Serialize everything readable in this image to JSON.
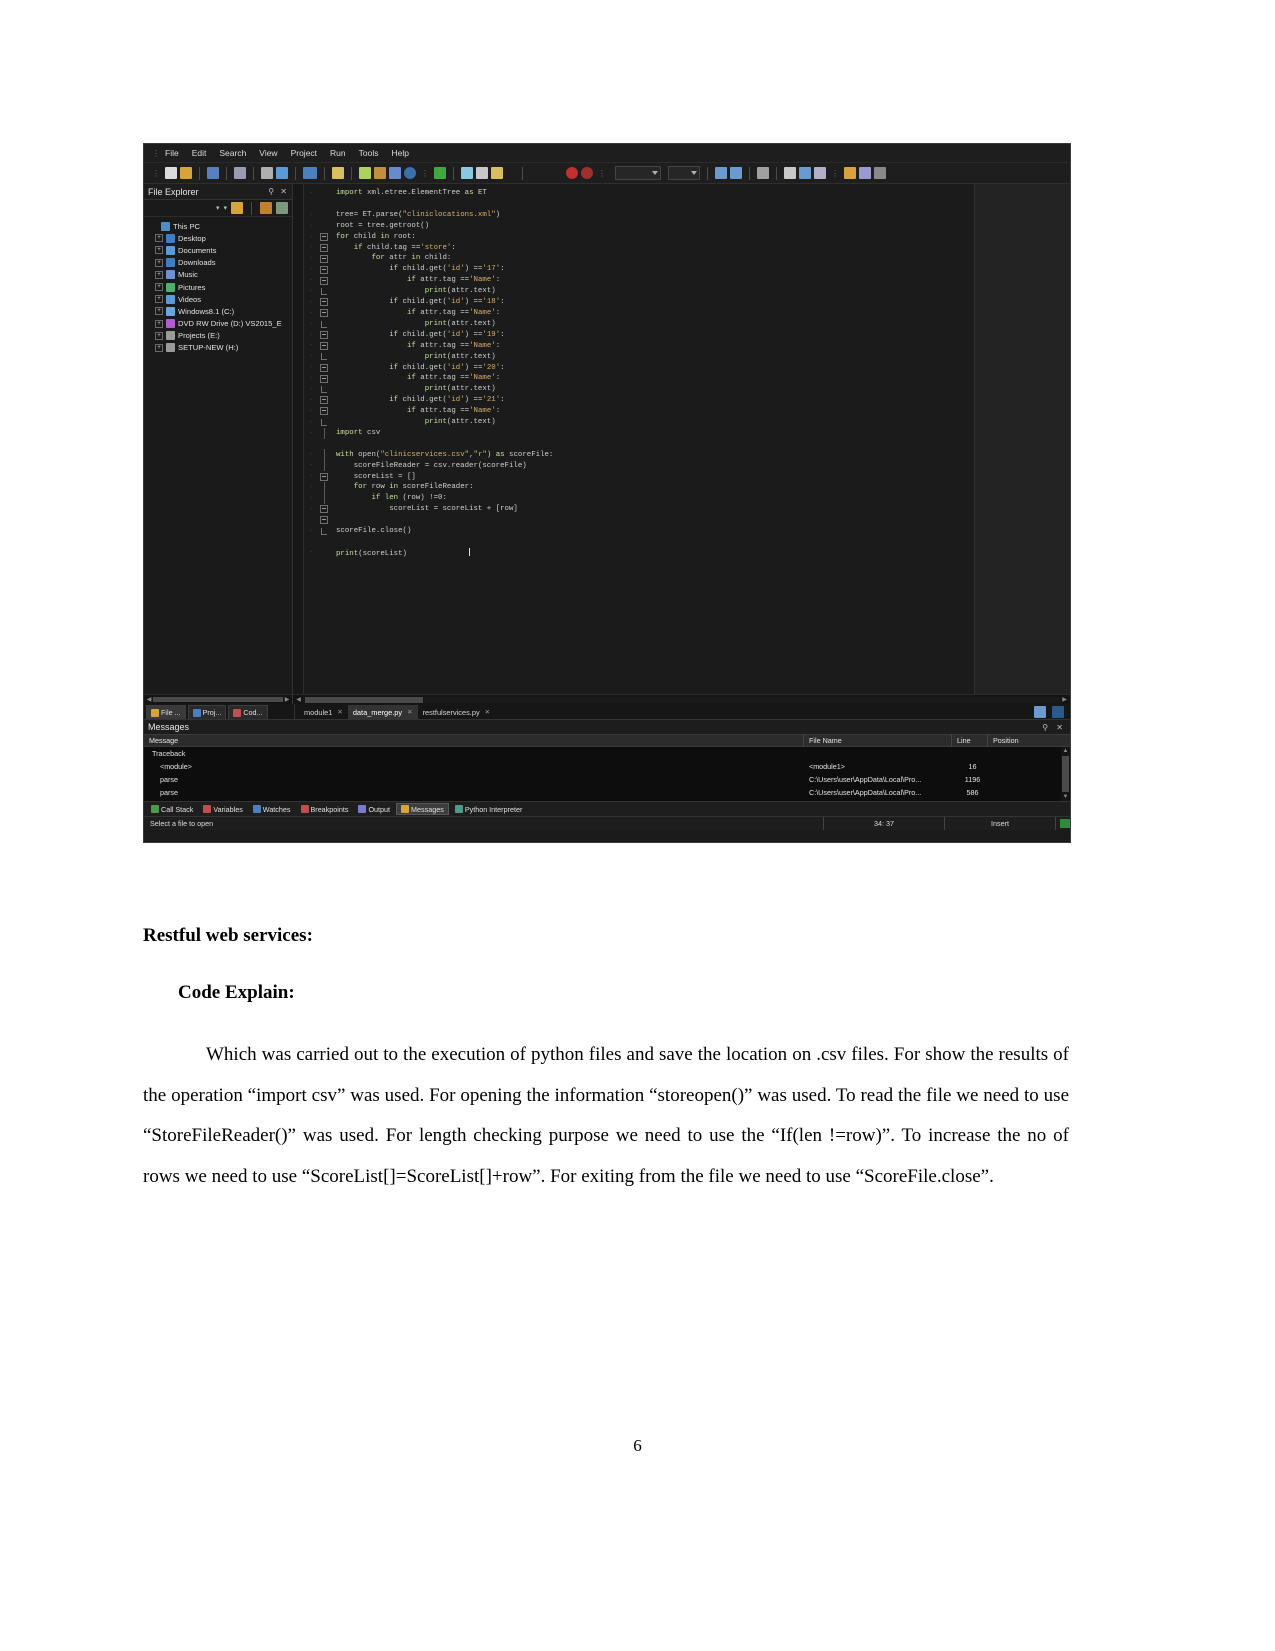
{
  "ide": {
    "menubar": {
      "items": [
        "File",
        "Edit",
        "Search",
        "View",
        "Project",
        "Run",
        "Tools",
        "Help"
      ]
    },
    "toolbar": {
      "icons": [
        "new-file-icon",
        "open-folder-icon",
        "save-icon",
        "print-icon",
        "cut-icon",
        "copy-icon",
        "undo-icon",
        "find-icon",
        "debug-icon",
        "module-icon",
        "window-icon",
        "info-icon",
        "run-icon",
        "debug-run-icon",
        "step-over-icon",
        "step-into-icon",
        "breakpoint-icon",
        "stop-icon",
        "bookmark-icon",
        "indent-icon",
        "outdent-icon",
        "comment-icon",
        "list-icon",
        "doc-icon",
        "format-icon",
        "settings-icon",
        "grid-icon",
        "panel-icon"
      ]
    },
    "explorer": {
      "title": "File Explorer",
      "pin_label": "⚲",
      "close_label": "✕",
      "tree": [
        {
          "label": "This PC",
          "indent": 0,
          "expandable": false,
          "icon_color": "#4a8fc8"
        },
        {
          "label": "Desktop",
          "indent": 1,
          "expandable": true,
          "icon_color": "#3f7fbf"
        },
        {
          "label": "Documents",
          "indent": 1,
          "expandable": true,
          "icon_color": "#5a9ad6"
        },
        {
          "label": "Downloads",
          "indent": 1,
          "expandable": true,
          "icon_color": "#3f7fbf"
        },
        {
          "label": "Music",
          "indent": 1,
          "expandable": true,
          "icon_color": "#6f8fcf"
        },
        {
          "label": "Pictures",
          "indent": 1,
          "expandable": true,
          "icon_color": "#4fae6f"
        },
        {
          "label": "Videos",
          "indent": 1,
          "expandable": true,
          "icon_color": "#5a9ad6"
        },
        {
          "label": "Windows8.1 (C:)",
          "indent": 1,
          "expandable": true,
          "icon_color": "#6aa6d9"
        },
        {
          "label": "DVD RW Drive (D:) VS2015_E",
          "indent": 1,
          "expandable": true,
          "icon_color": "#b05ecf"
        },
        {
          "label": "Projects (E:)",
          "indent": 1,
          "expandable": true,
          "icon_color": "#9a9a9a"
        },
        {
          "label": "SETUP-NEW (H:)",
          "indent": 1,
          "expandable": true,
          "icon_color": "#9a9a9a"
        }
      ]
    },
    "editor": {
      "code": "import xml.etree.ElementTree as ET\n\ntree= ET.parse(\"cliniclocations.xml\")\nroot = tree.getroot()\nfor child in root:\n    if child.tag =='store':\n        for attr in child:\n            if child.get('id') =='17':\n                if attr.tag =='Name':\n                    print(attr.text)\n            if child.get('id') =='18':\n                if attr.tag =='Name':\n                    print(attr.text)\n            if child.get('id') =='19':\n                if attr.tag =='Name':\n                    print(attr.text)\n            if child.get('id') =='20':\n                if attr.tag =='Name':\n                    print(attr.text)\n            if child.get('id') =='21':\n                if attr.tag =='Name':\n                    print(attr.text)\nimport csv\n\nwith open(\"clinicservices.csv\",\"r\") as scoreFile:\n    scoreFileReader = csv.reader(scoreFile)\n    scoreList = []\n    for row in scoreFileReader:\n        if len (row) !=0:\n            scoreList = scoreList + [row]\n\nscoreFile.close()\n\nprint(scoreList)"
    },
    "dock_left_tabs": [
      {
        "label": "File ...",
        "active": true,
        "icon_color": "#d8a33c"
      },
      {
        "label": "Proj...",
        "active": false,
        "icon_color": "#4a7fc0"
      },
      {
        "label": "Cod...",
        "active": false,
        "icon_color": "#c05050"
      }
    ],
    "editor_tabs": [
      {
        "label": "module1",
        "active": false,
        "close": "✕"
      },
      {
        "label": "data_merge.py",
        "active": true,
        "close": "✕"
      },
      {
        "label": "restfulservices.py",
        "active": false,
        "close": "✕"
      }
    ],
    "messages": {
      "title": "Messages",
      "pin_label": "⚲",
      "close_label": "✕",
      "columns": [
        "Message",
        "File Name",
        "Line",
        "Position"
      ],
      "rows": [
        {
          "message": "Traceback",
          "file": "",
          "line": "",
          "position": ""
        },
        {
          "message": "<module>",
          "file": "<module1>",
          "line": "16",
          "position": ""
        },
        {
          "message": "parse",
          "file": "C:\\Users\\user\\AppData\\Local\\Pro...",
          "line": "1196",
          "position": ""
        },
        {
          "message": "parse",
          "file": "C:\\Users\\user\\AppData\\Local\\Pro...",
          "line": "586",
          "position": ""
        }
      ]
    },
    "bottom_tabs": [
      {
        "label": "Call Stack",
        "active": false,
        "icon_color": "#4f9a4f"
      },
      {
        "label": "Variables",
        "active": false,
        "icon_color": "#c05050"
      },
      {
        "label": "Watches",
        "active": false,
        "icon_color": "#4a7fc0"
      },
      {
        "label": "Breakpoints",
        "active": false,
        "icon_color": "#c05050"
      },
      {
        "label": "Output",
        "active": false,
        "icon_color": "#7a7ad0"
      },
      {
        "label": "Messages",
        "active": true,
        "icon_color": "#d8a33c"
      },
      {
        "label": "Python Interpreter",
        "active": false,
        "icon_color": "#4f9a8a"
      }
    ],
    "statusbar": {
      "hint": "Select a file to open",
      "cursor": "34: 37",
      "mode": "Insert",
      "indicator_color": "#2d8a3e"
    }
  },
  "document": {
    "heading1": "Restful web services:",
    "heading2": "Code Explain:",
    "paragraph": "Which was carried out to the execution of python files and save the location on .csv files. For show the results of the operation “import csv” was used. For opening the information “storeopen()”  was used. To read the file we need to use “StoreFileReader()” was used. For length checking purpose we need to use the “If(len !=row)”. To increase the no of rows we need to use “ScoreList[]=ScoreList[]+row”. For exiting from the file we need to use “ScoreFile.close”.",
    "page_number": "6"
  }
}
